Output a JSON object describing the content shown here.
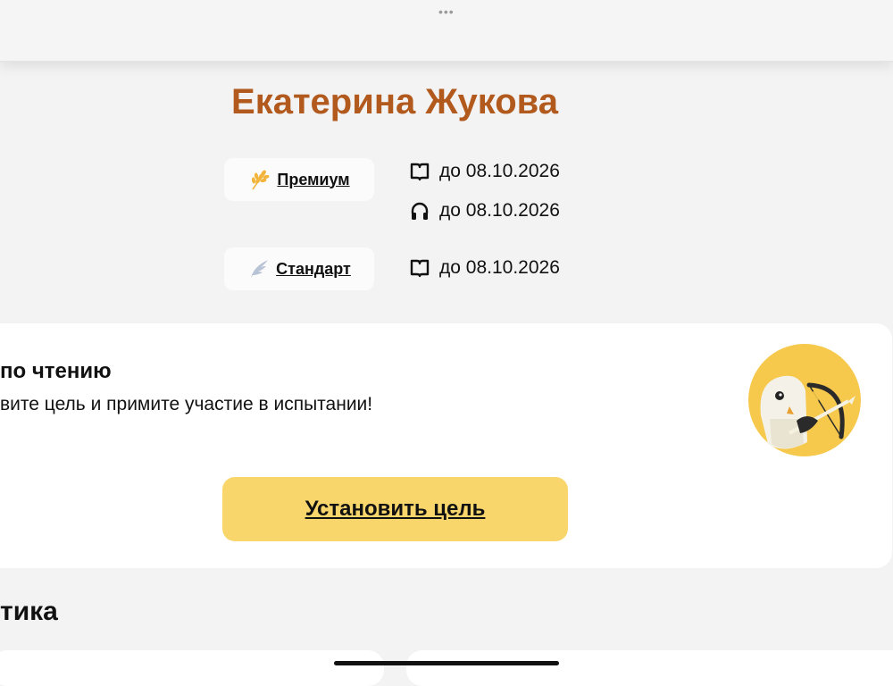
{
  "profile": {
    "name": "Екатерина Жукова"
  },
  "subscriptions": [
    {
      "label": "Премиум",
      "badge_icon": "wheat-icon",
      "badge_color": "#f2b43a",
      "validity": [
        {
          "icon": "book-icon",
          "text": "до 08.10.2026"
        },
        {
          "icon": "headphones-icon",
          "text": "до 08.10.2026"
        }
      ]
    },
    {
      "label": "Стандарт",
      "badge_icon": "wing-icon",
      "badge_color": "#b9c3d6",
      "validity": [
        {
          "icon": "book-icon",
          "text": "до 08.10.2026"
        }
      ]
    }
  ],
  "challenge": {
    "title": "по чтению",
    "text": "вите цель и примите участие в испытании!",
    "button_label": "Установить цель",
    "illustration": "owl-archer-illustration"
  },
  "stats": {
    "title": "тика"
  },
  "colors": {
    "accent_name": "#b25a1e",
    "button": "#f8d66c",
    "card": "#ffffff",
    "background": "#f3f3f3"
  }
}
